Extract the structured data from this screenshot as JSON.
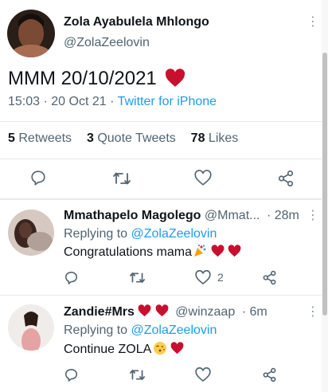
{
  "main_tweet": {
    "author_name": "Zola Ayabulela Mhlongo",
    "author_handle": "@ZolaZeelovin",
    "text": "MMM 20/10/2021",
    "timestamp": "15:03 · 20 Oct 21 · ",
    "client": "Twitter for iPhone",
    "stats": {
      "retweets_count": "5",
      "retweets_label": "Retweets",
      "quote_count": "3",
      "quote_label": "Quote Tweets",
      "likes_count": "78",
      "likes_label": "Likes"
    }
  },
  "replies": [
    {
      "author_name": "Mmathapelo Magolego",
      "author_handle": "@Mmat...",
      "time": "· 28m",
      "replying_prefix": "Replying to ",
      "replying_to": "@ZolaZeelovin",
      "text": "Congratulations mama",
      "like_count": "2"
    },
    {
      "author_name": "Zandie#Mrs",
      "author_handle": "@winzaap",
      "time": "· 6m",
      "replying_prefix": "Replying to ",
      "replying_to": "@ZolaZeelovin",
      "text": "Continue ZOLA"
    }
  ],
  "colors": {
    "accent": "#1d9bf0",
    "heart": "#c8102e",
    "secondary_text": "#536471"
  },
  "icons": [
    "more-icon",
    "reply-icon",
    "retweet-icon",
    "like-icon",
    "share-icon",
    "heart-emoji",
    "celebration-emoji",
    "kiss-emoji"
  ]
}
